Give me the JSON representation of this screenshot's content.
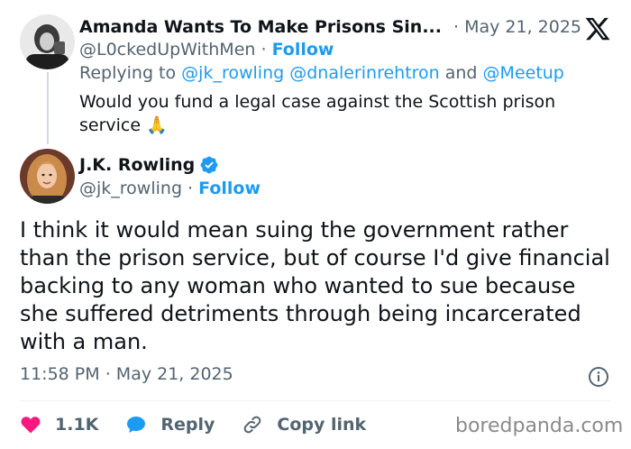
{
  "reply_tweet": {
    "author_name": "Amanda Wants To Make Prisons Sin...",
    "date": "May 21, 2025",
    "handle": "@L0ckedUpWithMen",
    "follow_label": "Follow",
    "replying_to_prefix": "Replying to",
    "replying_to_users": [
      "@jk_rowling",
      "@dnalerinrehtron",
      "@Meetup"
    ],
    "replying_to_and": "and",
    "body": "Would you fund a legal case against the Scottish prison service 🙏"
  },
  "main_tweet": {
    "author_name": "J.K. Rowling",
    "verified": true,
    "handle": "@jk_rowling",
    "follow_label": "Follow",
    "body": "I think it would mean suing the government rather than the prison service, but of course I'd give financial backing to any woman who wanted to sue because she suffered detriments through being incarcerated with a man.",
    "time": "11:58 PM",
    "date": "May 21, 2025"
  },
  "actions": {
    "like_count": "1.1K",
    "reply_label": "Reply",
    "copy_link_label": "Copy link"
  },
  "watermark": "boredpanda.com",
  "separator": "·",
  "icons": [
    "x-logo-icon",
    "verified-badge-icon",
    "info-icon",
    "heart-icon",
    "reply-bubble-icon",
    "link-icon"
  ],
  "colors": {
    "accent": "#1d9bf0",
    "like": "#f91880",
    "muted": "#536471",
    "text": "#0f1419"
  }
}
